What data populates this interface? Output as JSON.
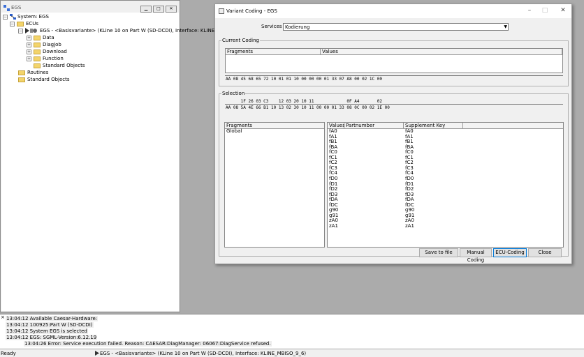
{
  "left_window": {
    "title": "EGS",
    "tree": {
      "system": "System: EGS",
      "ecus": "ECUs",
      "ecu": "EGS - <Basisvariante> (KLine 10 on Part W (SD-DCDI), Interface: KLINE",
      "data": "Data",
      "diagjob": "DiagJob",
      "download": "Download",
      "function": "Function",
      "standard_objects_child": "Standard Objects",
      "routines": "Routines",
      "standard_objects": "Standard Objects"
    }
  },
  "dialog": {
    "title": "Variant Coding - EGS",
    "services_label": "Services",
    "services_value": "Kodierung",
    "current_coding": {
      "label": "Current Coding",
      "columns": [
        "Fragments",
        "Values"
      ],
      "hex": "AA 08 45 68 65 72 10 01 01 10 00 00 00 01 33 07 A8 00 02 1C 00"
    },
    "selection": {
      "label": "Selection",
      "diff_line": "      1F 26 03 C3    12 03 20 10 11             0F A4       02",
      "hex": "AA 08 5A 4E 66 B1 10 13 02 30 10 11 00 00 01 33 08 0C 00 02 1E 00",
      "fragments_header": "Fragments",
      "fragments": [
        "Global"
      ],
      "columns": [
        "Values",
        "Partnumber",
        "Supplement Key"
      ],
      "rows": [
        {
          "value": "fA0",
          "partnumber": "",
          "key": "fA0"
        },
        {
          "value": "fA1",
          "partnumber": "",
          "key": "fA1"
        },
        {
          "value": "fB1",
          "partnumber": "",
          "key": "fB1"
        },
        {
          "value": "fBA",
          "partnumber": "",
          "key": "fBA"
        },
        {
          "value": "fC0",
          "partnumber": "",
          "key": "fC0"
        },
        {
          "value": "fC1",
          "partnumber": "",
          "key": "fC1"
        },
        {
          "value": "fC2",
          "partnumber": "",
          "key": "fC2"
        },
        {
          "value": "fC3",
          "partnumber": "",
          "key": "fC3"
        },
        {
          "value": "fC4",
          "partnumber": "",
          "key": "fC4"
        },
        {
          "value": "fD0",
          "partnumber": "",
          "key": "fD0"
        },
        {
          "value": "fD1",
          "partnumber": "",
          "key": "fD1"
        },
        {
          "value": "fD2",
          "partnumber": "",
          "key": "fD2"
        },
        {
          "value": "fD3",
          "partnumber": "",
          "key": "fD3"
        },
        {
          "value": "fDA",
          "partnumber": "",
          "key": "fDA"
        },
        {
          "value": "fDC",
          "partnumber": "",
          "key": "fDC"
        },
        {
          "value": "g90",
          "partnumber": "",
          "key": "g90"
        },
        {
          "value": "g91",
          "partnumber": "",
          "key": "g91"
        },
        {
          "value": "zA0",
          "partnumber": "",
          "key": "zA0"
        },
        {
          "value": "zA1",
          "partnumber": "",
          "key": "zA1"
        }
      ]
    },
    "buttons": {
      "save_to_file": "Save to file",
      "manual_coding": "Manual Coding",
      "ecu_coding": "ECU-Coding",
      "close": "Close"
    }
  },
  "log": [
    "13:04:12 Available Caesar-Hardware:",
    "13:04:12 100925:Part W (SD-DCDI)",
    "13:04:12 System EGS is selected",
    "13:04:12 EGS: SGML-Version:6.12.19",
    "13:04:26 Error: Service execution failed. Reason:  CAESAR:DiagManager: 06067:DiagService refused."
  ],
  "status": {
    "ready": "Ready",
    "info": "EGS - <Basisvariante> (KLine 10 on Part W (SD-DCDI), Interface: KLINE_MBISO_9_6)"
  }
}
